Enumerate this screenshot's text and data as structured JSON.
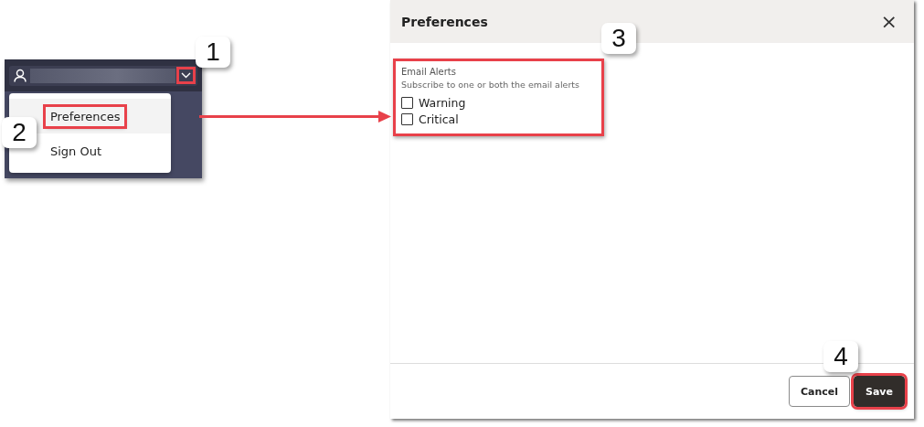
{
  "user_menu": {
    "chevron_highlighted": true,
    "items": [
      {
        "label": "Preferences",
        "selected": true,
        "highlighted": true
      },
      {
        "label": "Sign Out",
        "selected": false,
        "highlighted": false
      }
    ]
  },
  "dialog": {
    "title": "Preferences",
    "close": "×",
    "section": {
      "highlighted": true,
      "title": "Email Alerts",
      "description": "Subscribe to one or both the email alerts",
      "options": [
        {
          "label": "Warning",
          "checked": false
        },
        {
          "label": "Critical",
          "checked": false
        }
      ]
    },
    "buttons": [
      {
        "label": "Cancel",
        "kind": "secondary",
        "highlighted": false
      },
      {
        "label": "Save",
        "kind": "primary",
        "highlighted": true
      }
    ]
  },
  "callouts": [
    {
      "label": "1"
    },
    {
      "label": "2"
    },
    {
      "label": "3"
    },
    {
      "label": "4"
    }
  ]
}
